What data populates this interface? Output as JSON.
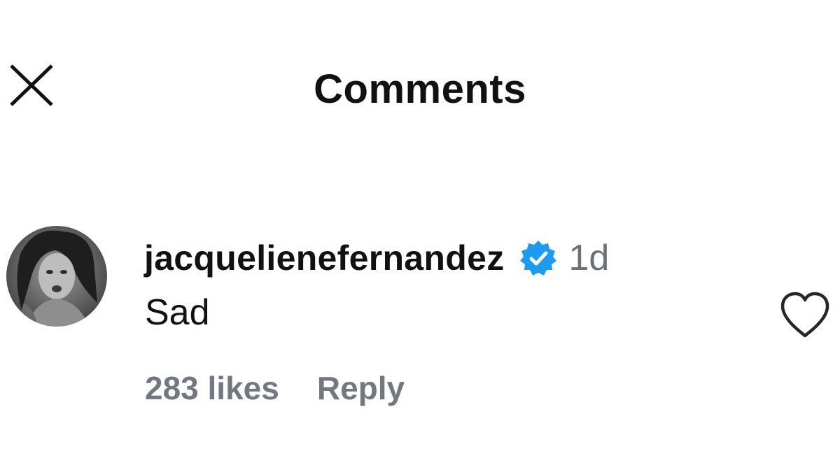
{
  "header": {
    "title": "Comments",
    "close_icon": "close-icon"
  },
  "comment": {
    "avatar_icon": "avatar",
    "username": "jacquelienefernandez",
    "verified_icon": "verified-badge-icon",
    "timestamp": "1d",
    "text": "Sad",
    "likes": "283 likes",
    "reply_label": "Reply",
    "like_icon": "heart-outline-icon"
  },
  "colors": {
    "verified_blue": "#1d9bf0",
    "secondary_text": "#737880",
    "primary_text": "#111111"
  }
}
